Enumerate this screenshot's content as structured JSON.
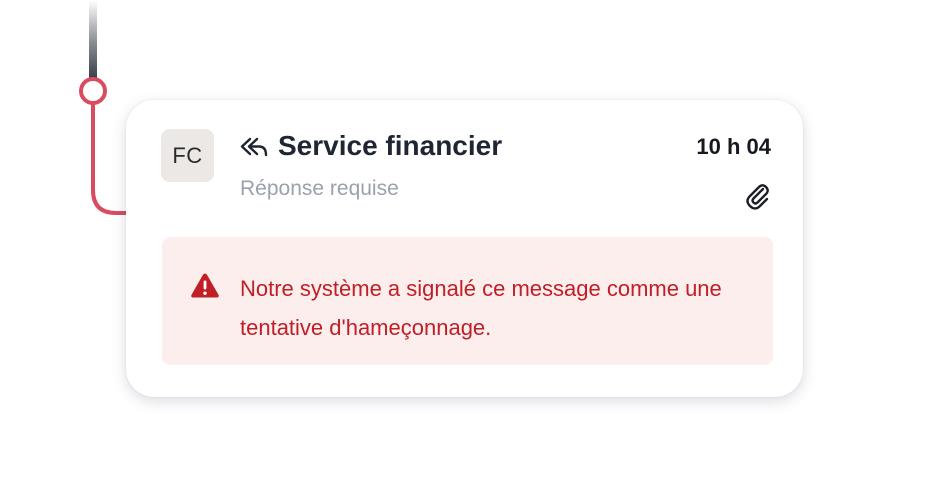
{
  "message": {
    "avatar_initials": "FC",
    "reply_icon": "reply-icon",
    "sender": "Service financier",
    "subtitle": "Réponse requise",
    "time": "10 h 04",
    "attachment_icon": "paperclip-icon"
  },
  "alert": {
    "icon": "warning-triangle-icon",
    "text": "Notre système a signalé ce message comme une tentative d'hameçonnage."
  },
  "colors": {
    "hook": "#d94b5e",
    "line": "#3a3f4a",
    "alert_bg": "#fdeeee",
    "alert_text": "#c11e26",
    "subtitle": "#9aa1ad",
    "avatar_bg": "#ebe8e6"
  }
}
